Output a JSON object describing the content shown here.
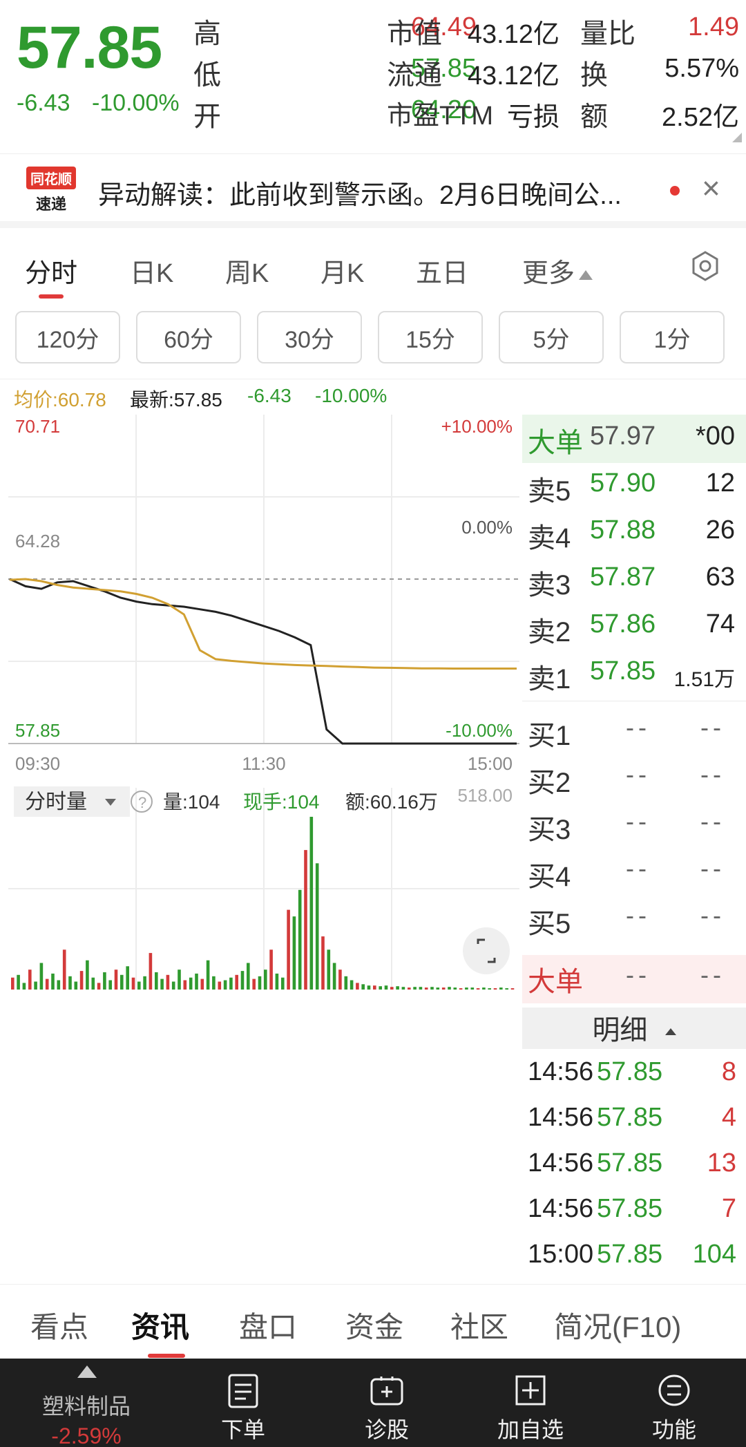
{
  "quote": {
    "price": "57.85",
    "change": "-6.43",
    "change_pct": "-10.00%",
    "stats": [
      {
        "label": "高",
        "value": "64.49",
        "color": "#d33a3a"
      },
      {
        "label": "低",
        "value": "57.85",
        "color": "#2f9a2f"
      },
      {
        "label": "开",
        "value": "64.20",
        "color": "#2f9a2f"
      },
      {
        "label": "市值",
        "value": "43.12亿",
        "color": "#222222"
      },
      {
        "label": "流通",
        "value": "43.12亿",
        "color": "#222222"
      },
      {
        "label": "市盈TTM",
        "value": "亏损",
        "color": "#222222"
      },
      {
        "label": "量比",
        "value": "1.49",
        "color": "#d33a3a"
      },
      {
        "label": "换",
        "value": "5.57%",
        "color": "#222222"
      },
      {
        "label": "额",
        "value": "2.52亿",
        "color": "#222222"
      }
    ]
  },
  "news": {
    "logo_top": "同花顺",
    "logo_bottom": "速递",
    "text": "异动解读：此前收到警示函。2月6日晚间公..."
  },
  "tabs": [
    "分时",
    "日K",
    "周K",
    "月K",
    "五日",
    "更多"
  ],
  "chips": [
    "120分",
    "60分",
    "30分",
    "15分",
    "5分",
    "1分"
  ],
  "info": {
    "avg_label": "均价:60.78",
    "latest_label": "最新:57.85",
    "change": "-6.43",
    "change_pct": "-10.00%"
  },
  "chart_data": {
    "type": "line",
    "x_ticks": [
      "09:30",
      "11:30",
      "15:00"
    ],
    "y_left_labels": [
      "70.71",
      "64.28",
      "57.85"
    ],
    "y_right_labels": [
      "+10.00%",
      "0.00%",
      "-10.00%"
    ],
    "ylim": [
      57.85,
      70.71
    ],
    "series": [
      {
        "color": "#222222",
        "values": [
          64.28,
          64.0,
          63.9,
          64.15,
          64.2,
          64.0,
          63.8,
          63.55,
          63.4,
          63.3,
          63.25,
          63.2,
          63.1,
          63.0,
          62.85,
          62.65,
          62.45,
          62.25,
          62.0,
          61.7,
          58.4,
          57.85,
          57.85,
          57.85,
          57.85,
          57.85,
          57.85,
          57.85,
          57.85,
          57.85,
          57.85,
          57.85,
          57.85
        ]
      },
      {
        "color": "#d1a032",
        "values": [
          64.25,
          64.28,
          64.2,
          64.05,
          63.95,
          63.9,
          63.85,
          63.8,
          63.7,
          63.55,
          63.3,
          62.9,
          61.5,
          61.15,
          61.08,
          61.03,
          60.98,
          60.95,
          60.92,
          60.9,
          60.88,
          60.86,
          60.84,
          60.82,
          60.81,
          60.8,
          60.79,
          60.79,
          60.78,
          60.78,
          60.78,
          60.78,
          60.78
        ]
      }
    ]
  },
  "volume": {
    "label": "分时量",
    "vol_label": "量:104",
    "hand_label": "现手:104",
    "amount_label": "额:60.16万",
    "max_label": "518.00",
    "bars": [
      18,
      22,
      10,
      30,
      12,
      40,
      16,
      24,
      14,
      60,
      20,
      12,
      28,
      44,
      18,
      10,
      26,
      14,
      30,
      22,
      35,
      18,
      12,
      20,
      55,
      26,
      16,
      22,
      12,
      30,
      14,
      18,
      24,
      16,
      44,
      20,
      12,
      14,
      18,
      22,
      28,
      40,
      16,
      20,
      30,
      60,
      24,
      18,
      120,
      110,
      150,
      210,
      260,
      190,
      80,
      60,
      40,
      30,
      20,
      14,
      10,
      8,
      6,
      6,
      5,
      6,
      4,
      5,
      4,
      3,
      4,
      4,
      3,
      4,
      3,
      3,
      4,
      3,
      2,
      3,
      3,
      2,
      3,
      2,
      2,
      3,
      2,
      2
    ]
  },
  "orderbook": {
    "big_label": "大单",
    "big_price": "57.97",
    "big_qty": "*00",
    "sells": [
      {
        "label": "卖5",
        "price": "57.90",
        "qty": "12"
      },
      {
        "label": "卖4",
        "price": "57.88",
        "qty": "26"
      },
      {
        "label": "卖3",
        "price": "57.87",
        "qty": "63"
      },
      {
        "label": "卖2",
        "price": "57.86",
        "qty": "74"
      },
      {
        "label": "卖1",
        "price": "57.85",
        "qty": "1.51万"
      }
    ],
    "buys": [
      {
        "label": "买1",
        "price": "--",
        "qty": "--"
      },
      {
        "label": "买2",
        "price": "--",
        "qty": "--"
      },
      {
        "label": "买3",
        "price": "--",
        "qty": "--"
      },
      {
        "label": "买4",
        "price": "--",
        "qty": "--"
      },
      {
        "label": "买5",
        "price": "--",
        "qty": "--"
      }
    ],
    "big2_label": "大单",
    "big2_price": "--",
    "big2_qty": "--",
    "detail_label": "明细"
  },
  "details": [
    {
      "time": "14:56",
      "price": "57.85",
      "vol": "8"
    },
    {
      "time": "14:56",
      "price": "57.85",
      "vol": "4"
    },
    {
      "time": "14:56",
      "price": "57.85",
      "vol": "13"
    },
    {
      "time": "14:56",
      "price": "57.85",
      "vol": "7"
    },
    {
      "time": "15:00",
      "price": "57.85",
      "vol": "104"
    }
  ],
  "info_tabs": [
    "看点",
    "资讯",
    "盘口",
    "资金",
    "社区",
    "简况(F10)"
  ],
  "bottom_nav": {
    "sector_name": "塑料制品",
    "sector_pct": "-2.59%",
    "items": [
      "下单",
      "诊股",
      "加自选",
      "功能"
    ]
  }
}
